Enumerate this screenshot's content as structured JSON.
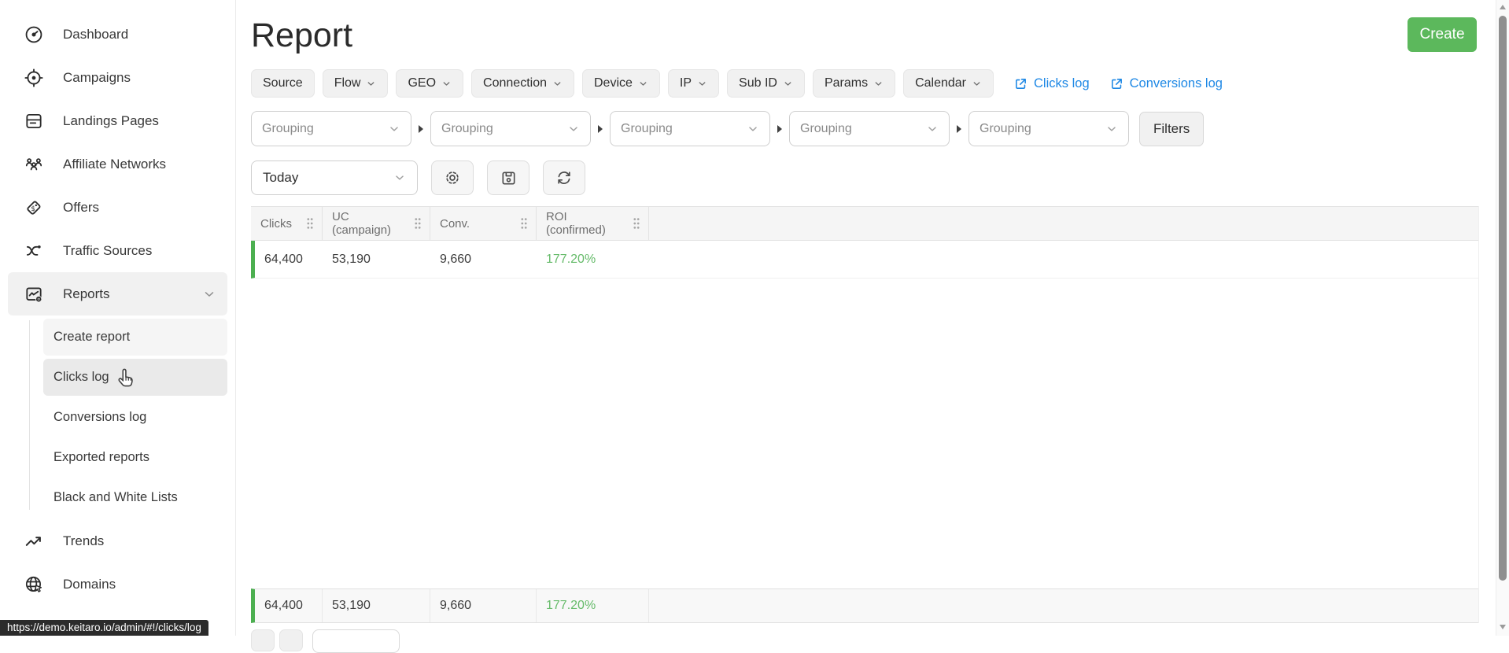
{
  "header": {
    "title": "Report",
    "create_label": "Create"
  },
  "sidebar": {
    "items": [
      {
        "label": "Dashboard"
      },
      {
        "label": "Campaigns"
      },
      {
        "label": "Landings Pages"
      },
      {
        "label": "Affiliate Networks"
      },
      {
        "label": "Offers"
      },
      {
        "label": "Traffic Sources"
      },
      {
        "label": "Reports"
      },
      {
        "label": "Trends"
      },
      {
        "label": "Domains"
      }
    ],
    "sub_items": [
      {
        "label": "Create report"
      },
      {
        "label": "Clicks log"
      },
      {
        "label": "Conversions log"
      },
      {
        "label": "Exported reports"
      },
      {
        "label": "Black and White Lists"
      }
    ]
  },
  "filters": {
    "chips": [
      {
        "label": "Source"
      },
      {
        "label": "Flow"
      },
      {
        "label": "GEO"
      },
      {
        "label": "Connection"
      },
      {
        "label": "Device"
      },
      {
        "label": "IP"
      },
      {
        "label": "Sub ID"
      },
      {
        "label": "Params"
      },
      {
        "label": "Calendar"
      }
    ],
    "links": [
      {
        "label": "Clicks log"
      },
      {
        "label": "Conversions log"
      }
    ]
  },
  "grouping": {
    "placeholder": "Grouping",
    "filters_button": "Filters"
  },
  "toolbar": {
    "date_range": "Today"
  },
  "table": {
    "columns": [
      "Clicks",
      "UC (campaign)",
      "Conv.",
      "ROI (confirmed)"
    ],
    "rows": [
      {
        "clicks": "64,400",
        "uc": "53,190",
        "conv": "9,660",
        "roi": "177.20%"
      }
    ],
    "footer": {
      "clicks": "64,400",
      "uc": "53,190",
      "conv": "9,660",
      "roi": "177.20%"
    }
  },
  "statusbar": {
    "url": "https://demo.keitaro.io/admin/#!/clicks/log"
  },
  "colors": {
    "accent_green": "#4caf50",
    "create_green": "#5cb85c",
    "roi_green": "#66bb6a",
    "link_blue": "#1e88e5"
  }
}
